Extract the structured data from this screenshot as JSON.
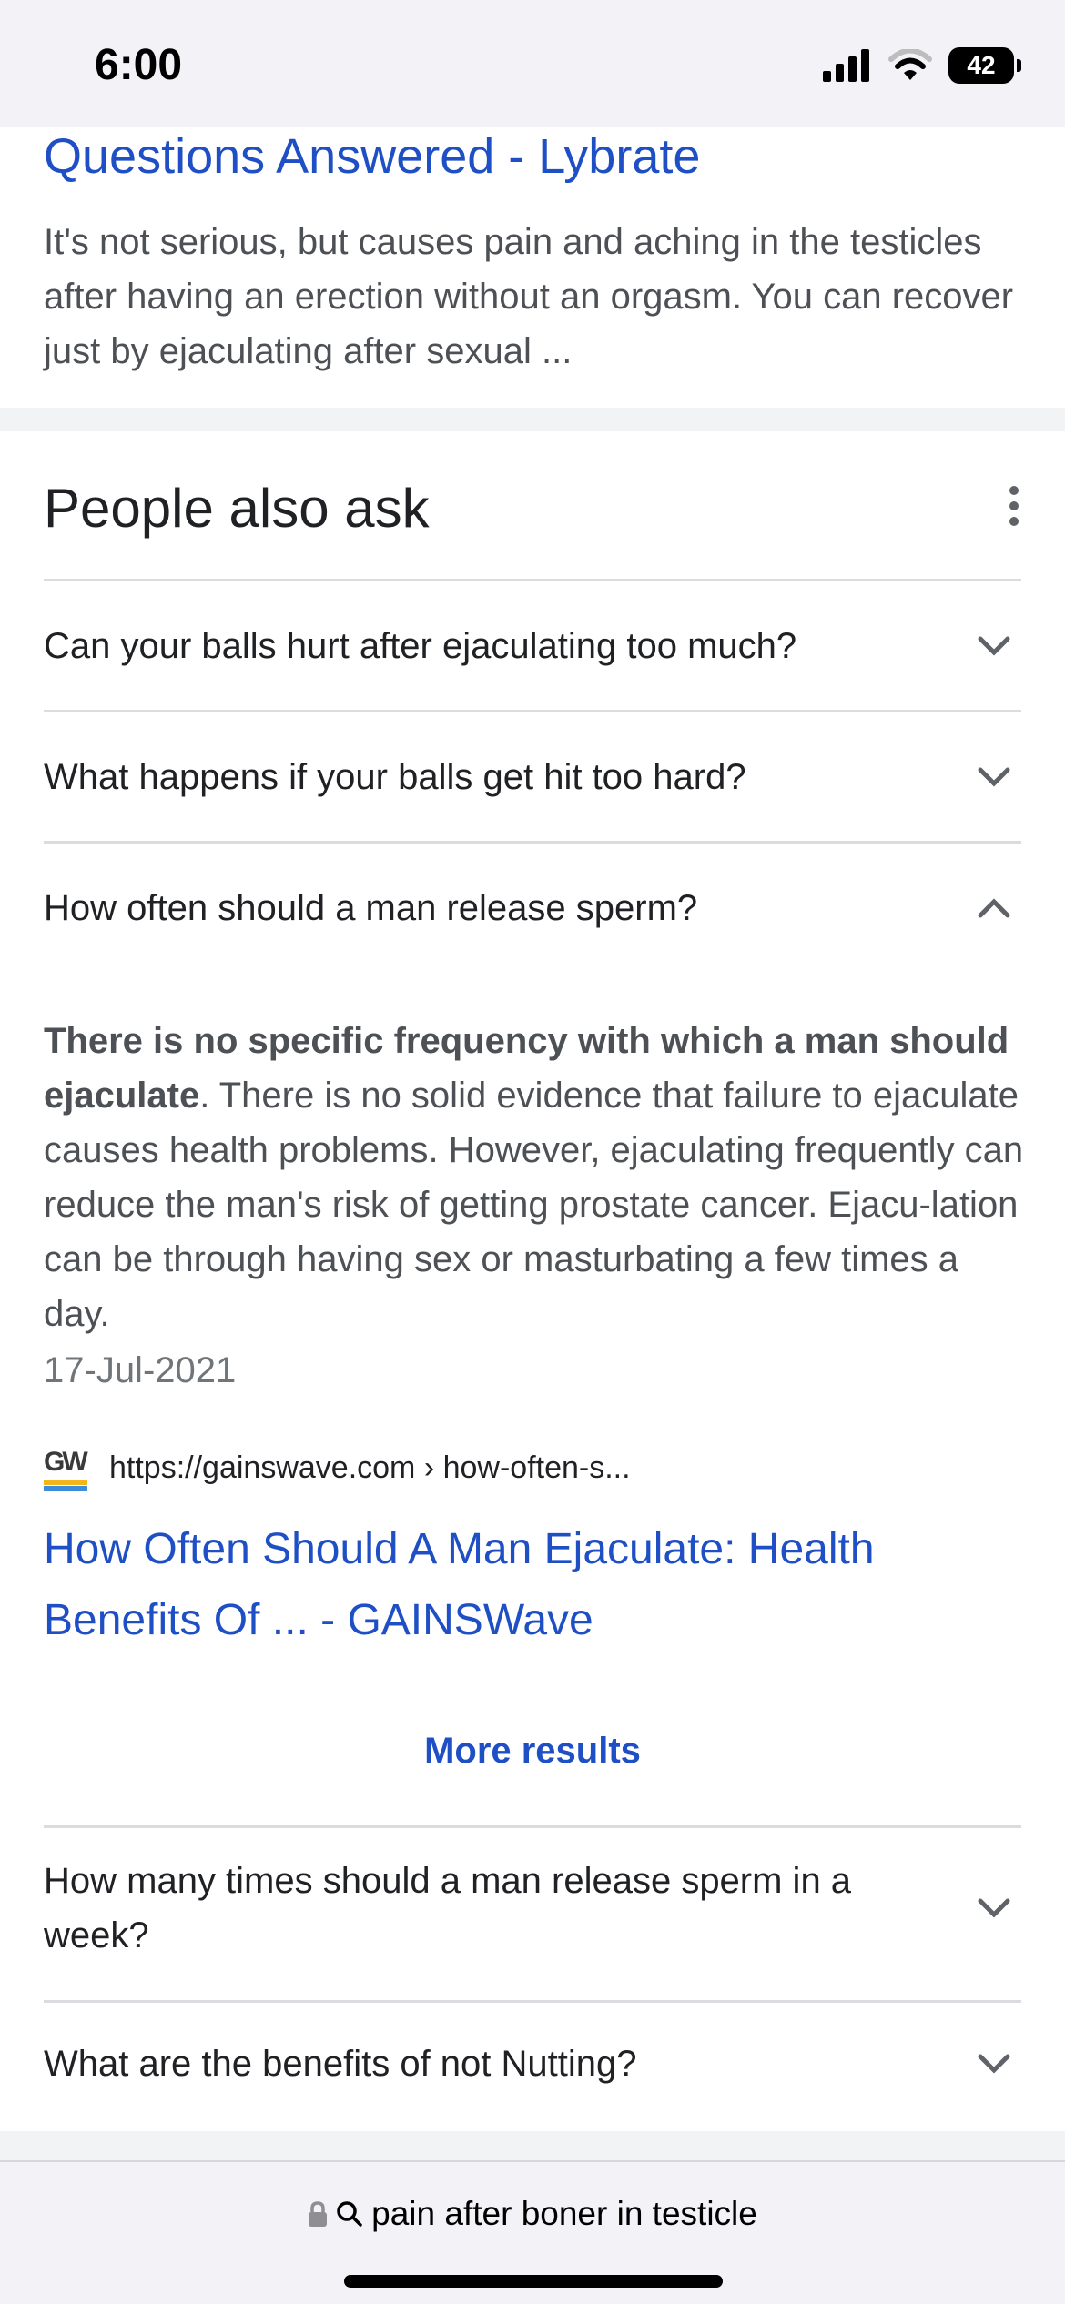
{
  "status_bar": {
    "time": "6:00",
    "battery": "42"
  },
  "top_result": {
    "title": "Questions Answered - Lybrate",
    "snippet": "It's not serious, but causes pain and aching in the testicles after having an erection without an orgasm. You can recover just by ejaculating after sexual ..."
  },
  "people_also_ask": {
    "heading": "People also ask",
    "questions": [
      {
        "text": "Can your balls hurt after ejaculating too much?",
        "expanded": false
      },
      {
        "text": "What happens if your balls get hit too hard?",
        "expanded": false
      },
      {
        "text": "How often should a man release sperm?",
        "expanded": true
      },
      {
        "text": "How many times should a man release sperm in a week?",
        "expanded": false
      },
      {
        "text": "What are the benefits of not Nutting?",
        "expanded": false
      }
    ],
    "answer": {
      "bold": "There is no specific frequency with which a man should ejaculate",
      "rest": ". There is no solid evidence that failure to ejaculate causes health problems. However, ejaculating frequently can reduce the man's risk of getting prostate cancer. Ejacu-lation can be through having sex or masturbating a few times a day.",
      "date": "17-Jul-2021",
      "favicon_text": "GW",
      "source_url": "https://gainswave.com › how-often-s...",
      "source_title": "How Often Should A Man Ejaculate: Health Benefits Of ... - GAINSWave"
    },
    "more_results": "More results"
  },
  "address_bar": {
    "query": "pain after boner in testicle"
  },
  "colors": {
    "link": "#1f4fc4",
    "snippet_text": "#4d5156",
    "divider": "#dadce0"
  }
}
